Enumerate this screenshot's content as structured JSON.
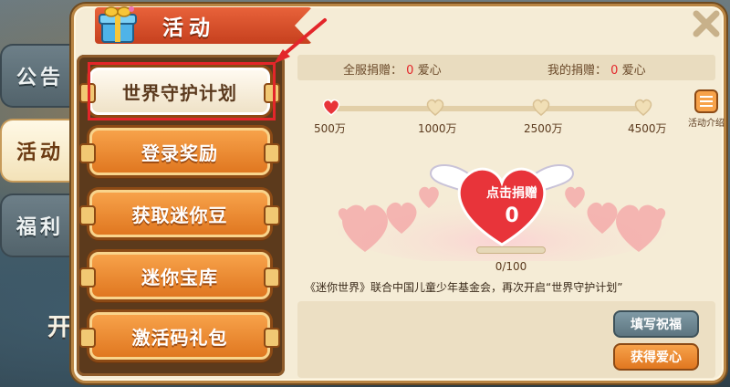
{
  "scene": {
    "partial_text": "开"
  },
  "side_tabs": [
    {
      "label": "公告"
    },
    {
      "label": "活动"
    },
    {
      "label": "福利"
    }
  ],
  "header": {
    "title": "活动"
  },
  "menu": [
    {
      "label": "世界守护计划",
      "active": true
    },
    {
      "label": "登录奖励"
    },
    {
      "label": "获取迷你豆"
    },
    {
      "label": "迷你宝库"
    },
    {
      "label": "激活码礼包"
    }
  ],
  "stats": {
    "server_label": "全服捐赠：",
    "server_value": "0",
    "server_unit": "爱心",
    "my_label": "我的捐赠：",
    "my_value": "0",
    "my_unit": "爱心"
  },
  "milestones": [
    "500万",
    "1000万",
    "2500万",
    "4500万"
  ],
  "intro": {
    "label": "活动介绍"
  },
  "donate": {
    "label": "点击捐赠",
    "count": "0",
    "progress_text": "0/100",
    "progress_fraction": 0
  },
  "description": "《迷你世界》联合中国儿童少年基金会，再次开启“世界守护计划”",
  "buttons": {
    "write_blessing": "填写祝福",
    "get_love": "获得爱心"
  },
  "colors": {
    "accent_orange": "#e07720",
    "highlight_red": "#e3262a",
    "heart_red": "#e8343a"
  }
}
